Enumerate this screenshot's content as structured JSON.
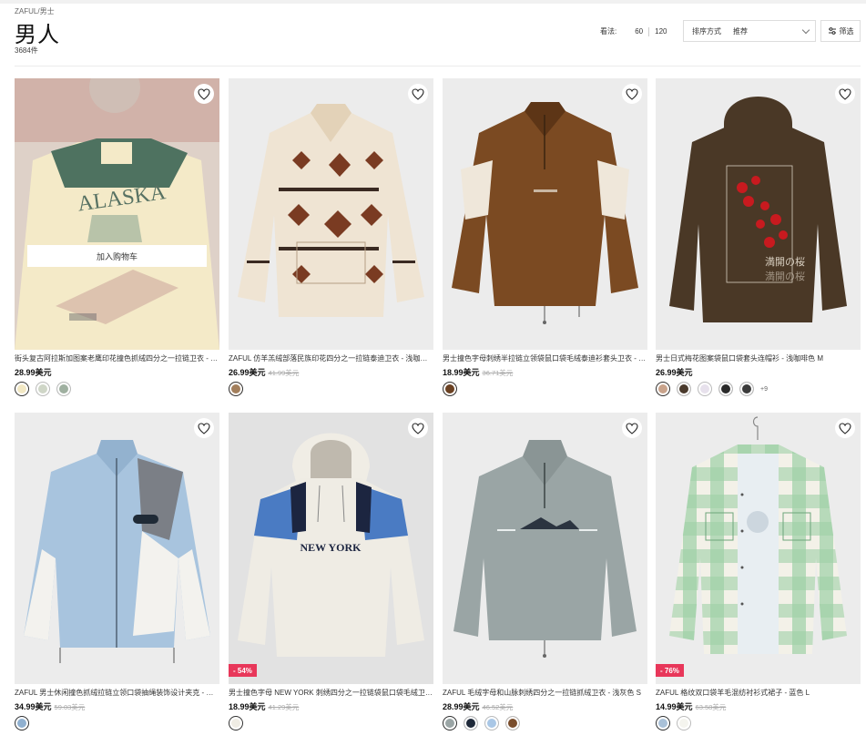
{
  "breadcrumb": {
    "home": "ZAFUL",
    "sep": "/",
    "current": "男士"
  },
  "page_title": "男人",
  "result_count": "3684件",
  "view": {
    "label": "看法:",
    "opt1": "60",
    "opt2": "120"
  },
  "sort": {
    "label": "排序方式",
    "value": "推荐"
  },
  "filter_label": "筛选",
  "add_to_cart": "加入购物车",
  "products": [
    {
      "title": "街头复古阿拉斯加图案老鹰印花撞色抓绒四分之一拉链卫衣 - 黄色 S",
      "price": "28.99美元",
      "old": "",
      "badge": "",
      "swatches": [
        "#f2e8c4",
        "#cfd6c7",
        "#9fb0a0"
      ],
      "more": ""
    },
    {
      "title": "ZAFUL 仿羊羔绒部落民族印花四分之一拉链泰迪卫衣 - 浅咖啡色 M",
      "price": "26.99美元",
      "old": "41.99美元",
      "badge": "",
      "swatches": [
        "#a37f5c"
      ],
      "more": ""
    },
    {
      "title": "男士撞色字母刺绣半拉链立领袋鼠口袋毛绒泰迪衫套头卫衣 - 咖啡色 M",
      "price": "18.99美元",
      "old": "36.71美元",
      "badge": "",
      "swatches": [
        "#6b4122"
      ],
      "more": ""
    },
    {
      "title": "男士日式梅花图案袋鼠口袋套头连帽衫 - 浅咖啡色 M",
      "price": "26.99美元",
      "old": "",
      "badge": "",
      "swatches": [
        "#c9a38b",
        "#4a3a2c",
        "#e7e1ec",
        "#2a2a2a",
        "#3b3b3b"
      ],
      "more": "+9"
    },
    {
      "title": "ZAFUL 男士休闲撞色抓绒拉链立领口袋抽绳装饰设计夹克 - 浅蓝色 M",
      "price": "34.99美元",
      "old": "59.03美元",
      "badge": "",
      "swatches": [
        "#8fb0d0"
      ],
      "more": ""
    },
    {
      "title": "男士撞色字母 NEW YORK 刺绣四分之一拉链袋鼠口袋毛绒卫衣 - 白色 M",
      "price": "18.99美元",
      "old": "41.29美元",
      "badge": "- 54%",
      "swatches": [
        "#efece4"
      ],
      "more": ""
    },
    {
      "title": "ZAFUL 毛绒字母和山脉刺绣四分之一拉链抓绒卫衣 - 浅灰色 S",
      "price": "28.99美元",
      "old": "46.52美元",
      "badge": "",
      "swatches": [
        "#9aa5a5",
        "#1f2a3a",
        "#a9c7e6",
        "#7a4d2c"
      ],
      "more": ""
    },
    {
      "title": "ZAFUL 格纹双口袋羊毛混纺衬衫式裙子 - 蓝色 L",
      "price": "14.99美元",
      "old": "63.58美元",
      "badge": "- 76%",
      "swatches": [
        "#a9c1d8",
        "#f4f4ee"
      ],
      "more": ""
    }
  ],
  "colors": {
    "sale_badge": "#e8375a",
    "wood_brown": "#7b4a22",
    "hoodie_brown": "#4a3826",
    "light_blue": "#a8c4de"
  }
}
